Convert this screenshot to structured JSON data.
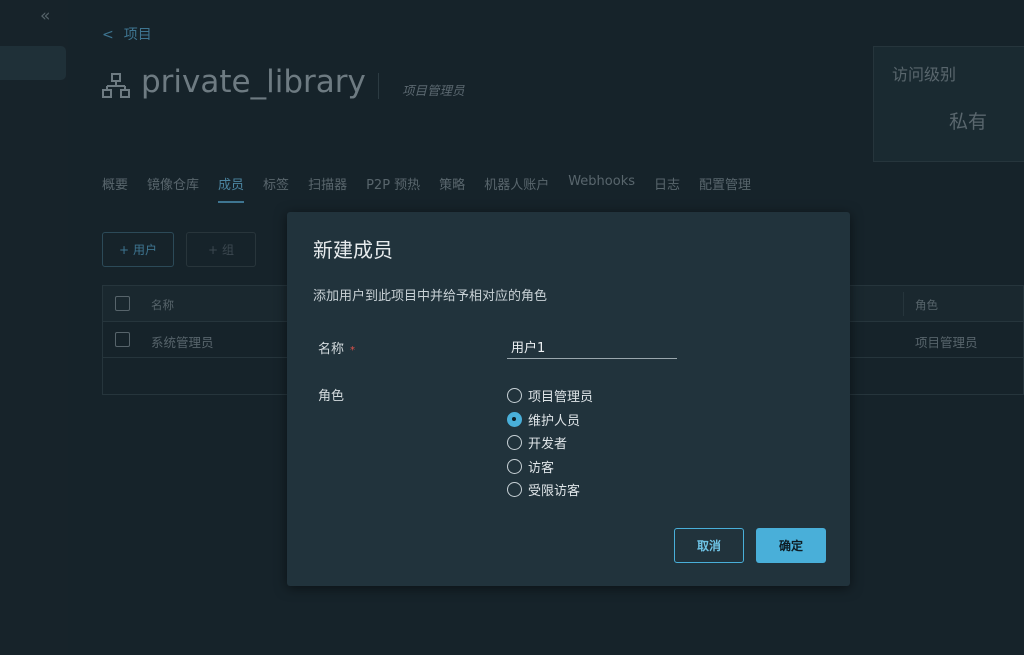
{
  "nav": {
    "collapse_glyph": "«",
    "back_glyph": "<",
    "back_label": "项目"
  },
  "project": {
    "name": "private_library",
    "role": "项目管理员"
  },
  "access": {
    "label": "访问级别",
    "value": "私有"
  },
  "tabs": [
    {
      "label": "概要"
    },
    {
      "label": "镜像仓库"
    },
    {
      "label": "成员",
      "active": true
    },
    {
      "label": "标签"
    },
    {
      "label": "扫描器"
    },
    {
      "label": "P2P 预热"
    },
    {
      "label": "策略"
    },
    {
      "label": "机器人账户"
    },
    {
      "label": "Webhooks"
    },
    {
      "label": "日志"
    },
    {
      "label": "配置管理"
    }
  ],
  "toolbar": {
    "add_user_label": "用户",
    "add_group_label": "组",
    "plus_glyph": "+"
  },
  "members_table": {
    "columns": {
      "name": "名称",
      "role": "角色"
    },
    "rows": [
      {
        "name": "系统管理员",
        "role": "项目管理员"
      }
    ]
  },
  "modal": {
    "title": "新建成员",
    "description": "添加用户到此项目中并给予相对应的角色",
    "name_label": "名称",
    "required_mark": "*",
    "name_value": "用户1",
    "role_label": "角色",
    "roles": [
      {
        "label": "项目管理员",
        "selected": false
      },
      {
        "label": "维护人员",
        "selected": true
      },
      {
        "label": "开发者",
        "selected": false
      },
      {
        "label": "访客",
        "selected": false
      },
      {
        "label": "受限访客",
        "selected": false
      }
    ],
    "cancel_label": "取消",
    "ok_label": "确定"
  },
  "colors": {
    "accent": "#49afd9",
    "modal_bg": "#21333c",
    "page_bg": "#16232a",
    "required": "#e0524a"
  }
}
